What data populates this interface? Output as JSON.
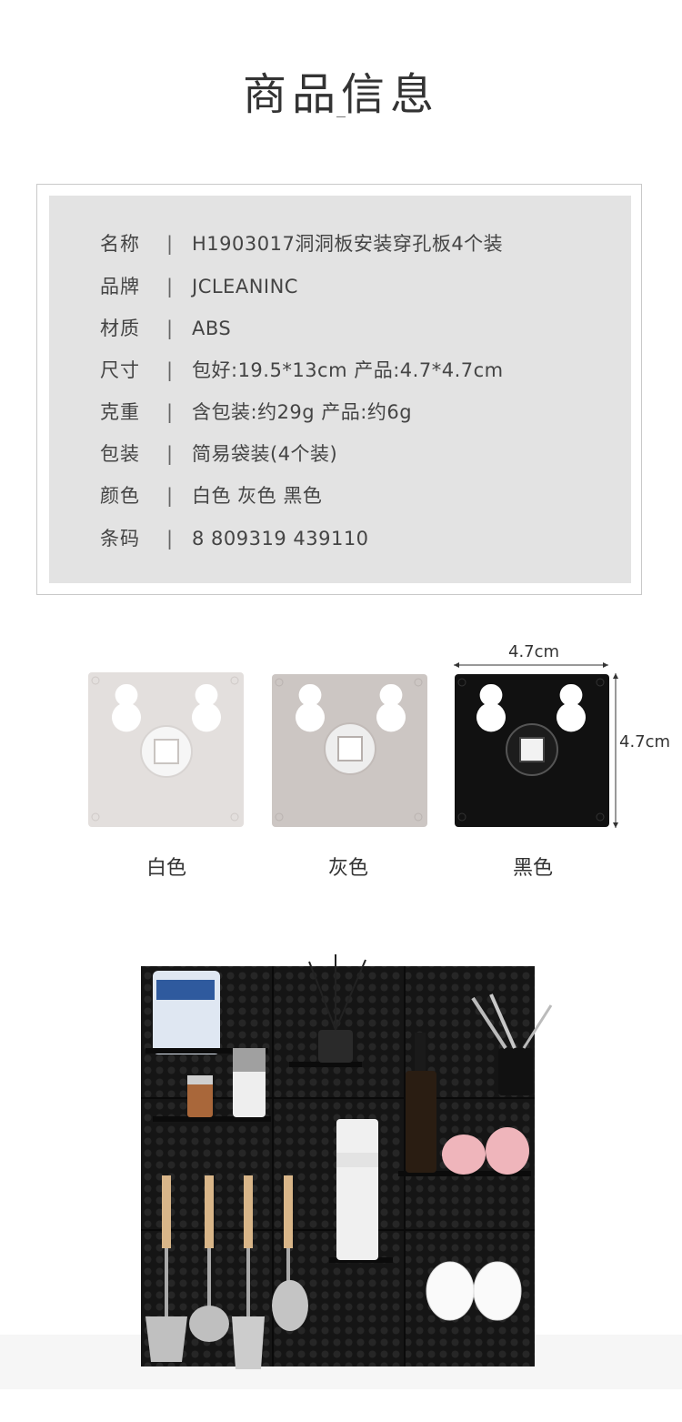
{
  "header": {
    "title": "商品信息"
  },
  "info": {
    "separator": "|",
    "rows": [
      {
        "key": "名称",
        "value": "H1903017洞洞板安装穿孔板4个装"
      },
      {
        "key": "品牌",
        "value": "JCLEANINC"
      },
      {
        "key": "材质",
        "value": "ABS"
      },
      {
        "key": "尺寸",
        "value": "包好:19.5*13cm  产品:4.7*4.7cm"
      },
      {
        "key": "克重",
        "value": "含包装:约29g  产品:约6g"
      },
      {
        "key": "包装",
        "value": "简易袋装(4个装)"
      },
      {
        "key": "颜色",
        "value": "白色  灰色  黑色"
      },
      {
        "key": "条码",
        "value": "8  809319  439110"
      }
    ]
  },
  "colors": {
    "swatches": [
      {
        "label": "白色",
        "fill": "#e3dfdd"
      },
      {
        "label": "灰色",
        "fill": "#ccc6c3"
      },
      {
        "label": "黑色",
        "fill": "#111111"
      }
    ],
    "width_label": "4.7cm",
    "height_label": "4.7cm"
  }
}
